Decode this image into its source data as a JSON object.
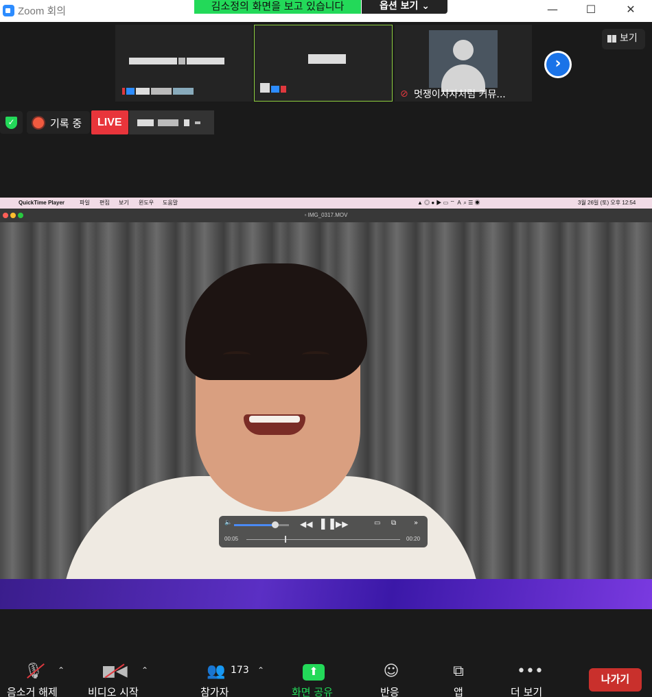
{
  "window": {
    "title": "Zoom 회의",
    "share_banner": "김소정의 화면을 보고 있습니다",
    "options_label": "옵션 보기 ⌄",
    "minimize": "—",
    "maximize": "☐",
    "close": "✕"
  },
  "thumbnails": [
    {
      "label": ""
    },
    {
      "label": ""
    },
    {
      "label": "멋쟁이사자처럼 커뮤..."
    }
  ],
  "view_button": {
    "label": "보기"
  },
  "status": {
    "recording_label": "기록 중",
    "live_label": "LIVE"
  },
  "shared_screen": {
    "menubar": {
      "app": "QuickTime Player",
      "items": [
        "파일",
        "편집",
        "보기",
        "윈도우",
        "도움말"
      ],
      "clock": "3월 26일 (토) 오후 12:54"
    },
    "file_title": "IMG_0317.MOV",
    "player": {
      "elapsed": "00:05",
      "total": "00:20",
      "volume_fraction": 0.75,
      "progress_fraction": 0.25
    }
  },
  "toolbar": {
    "mute_label": "음소거 해제",
    "video_label": "비디오 시작",
    "participants_label": "참가자",
    "participants_count": "173",
    "share_label": "화면 공유",
    "reactions_label": "반응",
    "apps_label": "앱",
    "more_label": "더 보기",
    "leave_label": "나가기"
  },
  "colors": {
    "share_green": "#23d959",
    "live_red": "#e8353b",
    "leave_red": "#c9302c",
    "next_blue": "#1a73e8"
  }
}
